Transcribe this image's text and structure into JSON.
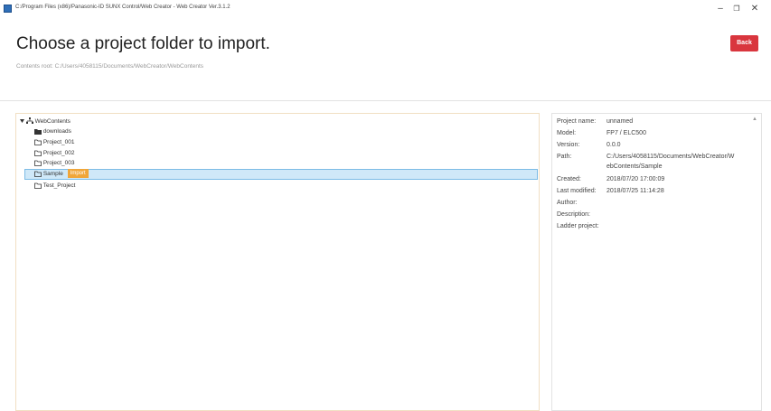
{
  "window": {
    "title": "C:/Program Files (x86)/Panasonic-ID SUNX Control/Web Creator - Web Creator Ver.3.1.2",
    "controls": [
      "–",
      "❐",
      "✕"
    ]
  },
  "header": {
    "title": "Choose a project folder to import.",
    "contents_root": "Contents root: C:/Users/4058115/Documents/WebCreator/WebContents",
    "back_label": "Back",
    "back_color": "#d9363e"
  },
  "tree": {
    "root_label": "WebContents",
    "items": [
      {
        "label": "downloads",
        "icon": "folder-filled-icon",
        "selected": false
      },
      {
        "label": "Project_001",
        "icon": "folder-icon",
        "selected": false
      },
      {
        "label": "Project_002",
        "icon": "folder-icon",
        "selected": false
      },
      {
        "label": "Project_003",
        "icon": "folder-icon",
        "selected": false
      },
      {
        "label": "Sample",
        "icon": "folder-icon",
        "selected": true,
        "badge": "Import"
      },
      {
        "label": "Test_Project",
        "icon": "folder-icon",
        "selected": false
      }
    ],
    "selection_color": "#cfe8f8",
    "badge_color": "#f0a63a"
  },
  "info": {
    "project_name_label": "Project name:",
    "project_name": "unnamed",
    "model_label": "Model:",
    "model": "FP7 / ELC500",
    "version_label": "Version:",
    "version": "0.0.0",
    "path_label": "Path:",
    "path_line1": "C:/Users/4058115/Documents/WebCreator/W",
    "path_line2": "ebContents/Sample",
    "created_label": "Created:",
    "created": "2018/07/20 17:00:09",
    "modified_label": "Last modified:",
    "modified": "2018/07/25 11:14:28",
    "author_label": "Author:",
    "description_label": "Description:",
    "ladder_label": "Ladder project:"
  }
}
